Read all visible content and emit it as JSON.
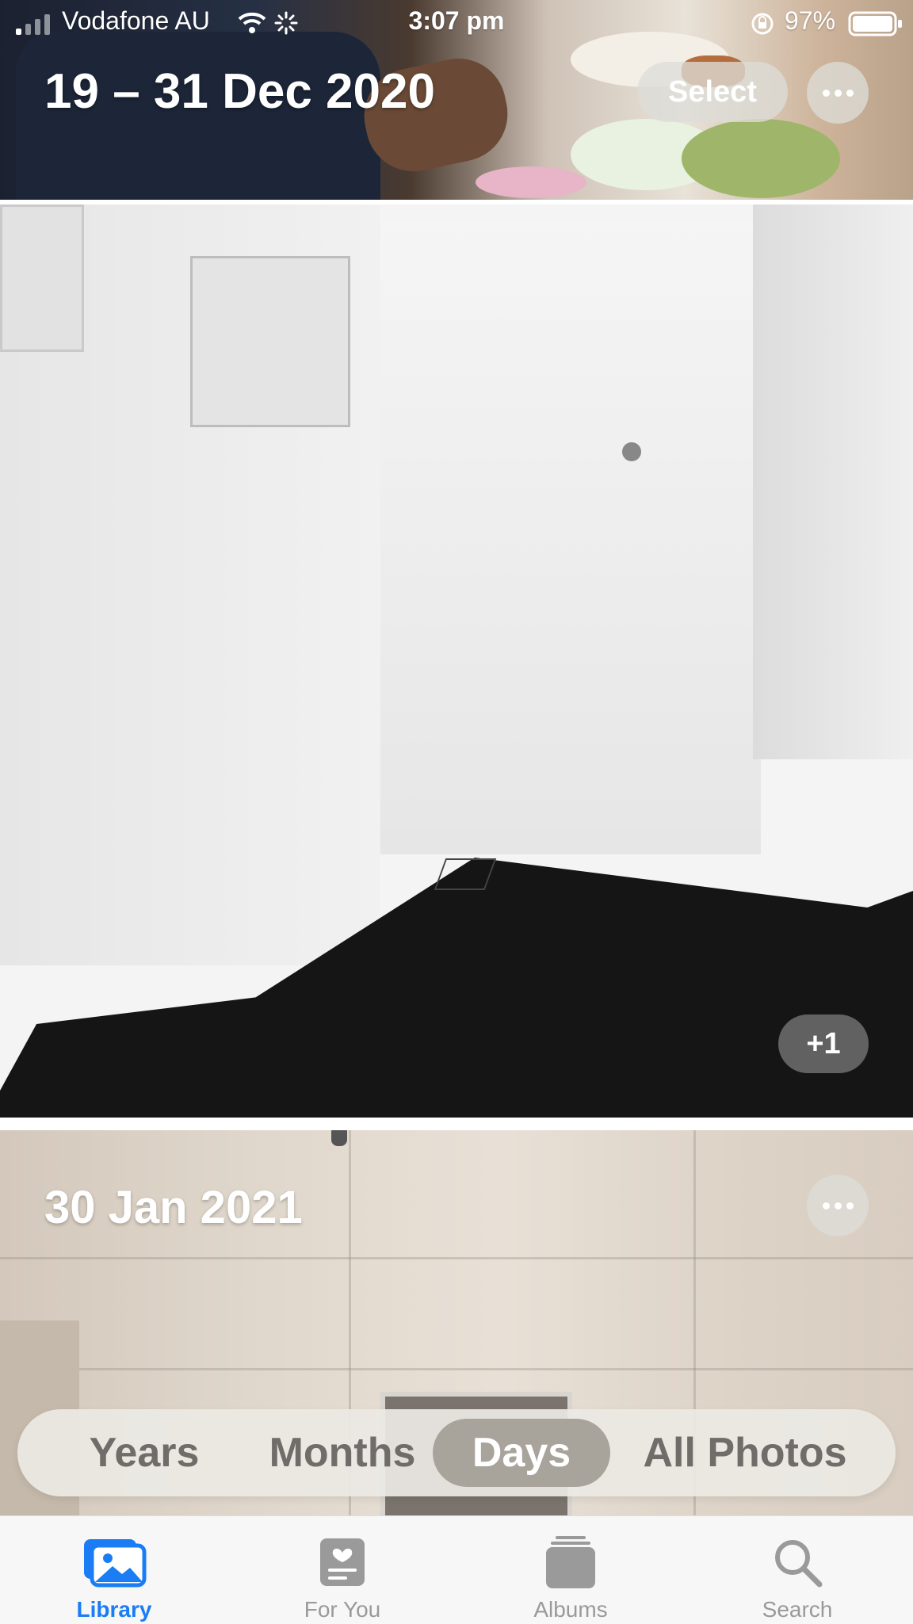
{
  "status_bar": {
    "carrier": "Vodafone AU",
    "time": "3:07 pm",
    "battery": "97%"
  },
  "sections": [
    {
      "date": "19 – 31 Dec 2020",
      "select_label": "Select"
    },
    {
      "extra_count": "+1"
    },
    {
      "date": "30 Jan 2021"
    }
  ],
  "segments": [
    "Years",
    "Months",
    "Days",
    "All Photos"
  ],
  "selected_segment": "Days",
  "tabs": [
    {
      "label": "Library",
      "icon": "photo-library-icon",
      "active": true
    },
    {
      "label": "For You",
      "icon": "for-you-icon",
      "active": false
    },
    {
      "label": "Albums",
      "icon": "albums-icon",
      "active": false
    },
    {
      "label": "Search",
      "icon": "search-icon",
      "active": false
    }
  ],
  "colors": {
    "accent": "#1a7df4",
    "inactive": "#9a9a9a"
  }
}
